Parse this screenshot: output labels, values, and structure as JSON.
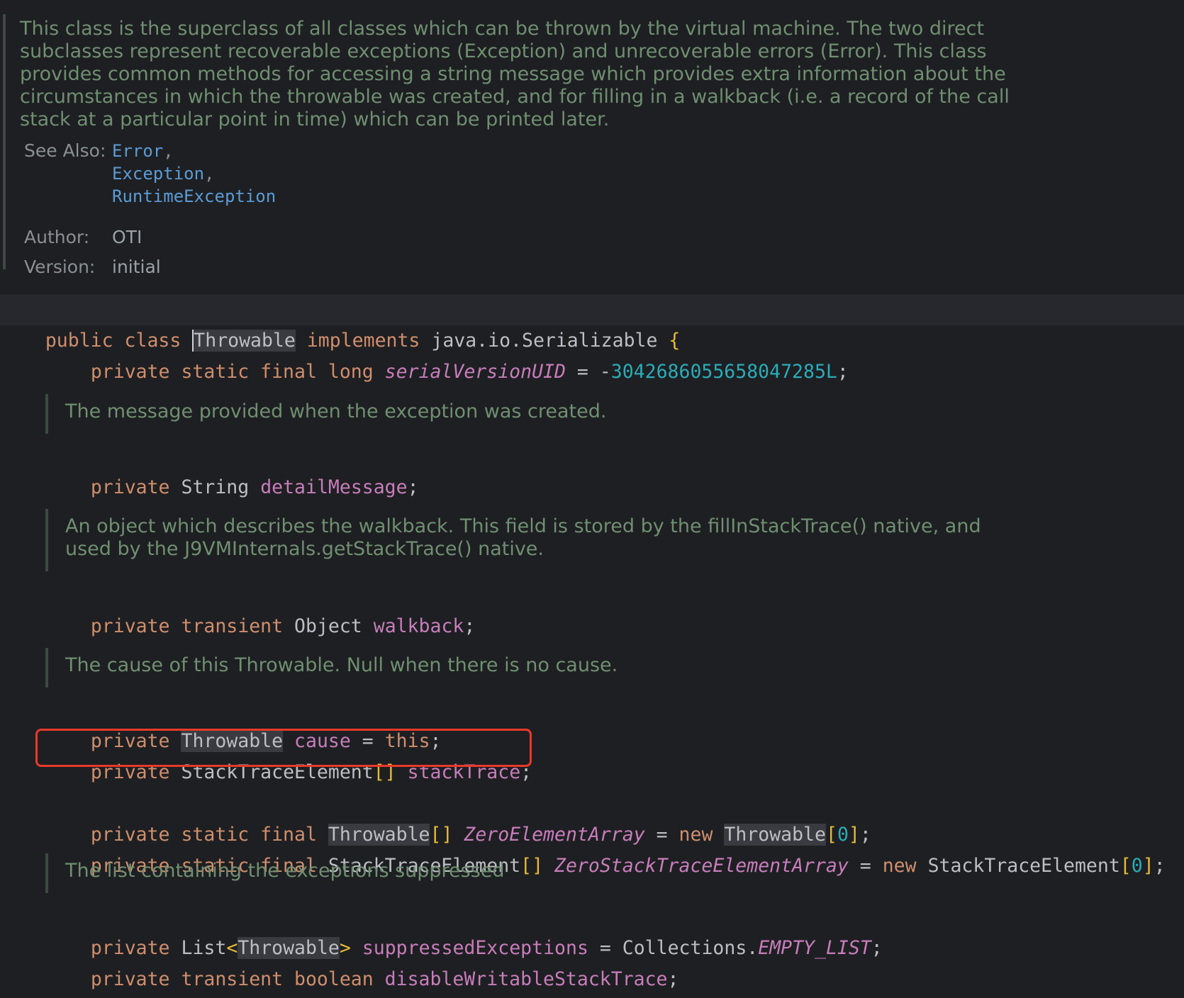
{
  "class_doc": {
    "lines": [
      "This class is the superclass of all classes which can be thrown by the virtual machine. The two direct",
      "subclasses represent recoverable exceptions (Exception) and unrecoverable errors (Error). This class",
      "provides common methods for accessing a string message which provides extra information about the",
      "circumstances in which the throwable was created, and for filling in a walkback (i.e. a record of the call",
      "stack at a particular point in time) which can be printed later."
    ],
    "see_also_label": "See Also:",
    "see_also": [
      "Error",
      "Exception",
      "RuntimeException"
    ],
    "comma": ",",
    "author_label": "Author:",
    "author": "OTI",
    "version_label": "Version:",
    "version": "initial"
  },
  "docs": {
    "detail_message": "The message provided when the exception was created.",
    "walkback_1": "An object which describes the walkback. This field is stored by the fillInStackTrace() native, and",
    "walkback_2": "used by the J9VMInternals.getStackTrace() native.",
    "cause": "The cause of this Throwable. Null when there is no cause.",
    "suppressed": "The list containing the exceptions suppressed"
  },
  "code": {
    "line_class": {
      "public": "public",
      "class": "class",
      "name": "Throwable",
      "implements": "implements",
      "iface": "java.io.Serializable",
      "brace": "{"
    },
    "line_serial": {
      "mods": "private static final long",
      "name": "serialVersionUID",
      "eq": " = -",
      "value": "3042686055658047285L",
      "end": ";"
    },
    "line_detail": {
      "mod": "private",
      "type": "String",
      "name": "detailMessage",
      "end": ";"
    },
    "line_walkback": {
      "mods": "private transient",
      "type": "Object",
      "name": "walkback",
      "end": ";"
    },
    "line_cause": {
      "mod": "private",
      "type": "Throwable",
      "name": "cause",
      "eq": " = ",
      "this": "this",
      "end": ";"
    },
    "line_stacktrace": {
      "mod": "private",
      "type": "StackTraceElement",
      "arr": "[]",
      "name": "stackTrace",
      "end": ";"
    },
    "line_zero_elem": {
      "mods": "private static final",
      "type": "Throwable",
      "arr": "[]",
      "name": "ZeroElementArray",
      "eq": " = ",
      "new": "new",
      "type2": "Throwable",
      "open": "[",
      "num": "0",
      "close": "]",
      "end": ";"
    },
    "line_zero_stack": {
      "mods": "private static final",
      "type": "StackTraceElement",
      "arr": "[]",
      "name": "ZeroStackTraceElementArray",
      "eq": " = ",
      "new": "new",
      "type2": "StackTraceElement",
      "open": "[",
      "num": "0",
      "close": "]",
      "end": ";"
    },
    "line_suppressed": {
      "mod": "private",
      "type": "List",
      "lt": "<",
      "generic": "Throwable",
      "gt": ">",
      "name": "suppressedExceptions",
      "eq": " = Collections.",
      "const": "EMPTY_LIST",
      "end": ";"
    },
    "line_disable": {
      "mods": "private transient boolean",
      "name": "disableWritableStackTrace",
      "end": ";"
    }
  },
  "colors": {
    "background": "#1e1f22",
    "keyword": "#cf8e6d",
    "field": "#c77dbb",
    "number": "#2aacb8",
    "doc_text": "#6f8f71",
    "link": "#5b9bd5",
    "annotation_box": "#e8392a"
  }
}
